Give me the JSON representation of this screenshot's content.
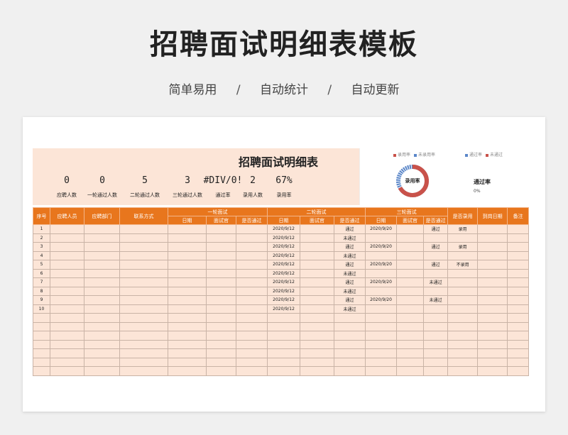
{
  "page_title": "招聘面试明细表模板",
  "tagline": [
    "简单易用",
    "自动统计",
    "自动更新"
  ],
  "tagline_sep": "/",
  "sheet": {
    "title": "招聘面试明细表",
    "stats": [
      {
        "value": "0",
        "label": "应聘人数"
      },
      {
        "value": "0",
        "label": "一轮通过人数"
      },
      {
        "value": "5",
        "label": "二轮通过人数"
      },
      {
        "value": "3",
        "label": "三轮通过人数"
      },
      {
        "value": "#DIV/0!",
        "label": "通过率"
      },
      {
        "value": "2",
        "label": "录用人数"
      },
      {
        "value": "67%",
        "label": "录用率"
      }
    ],
    "chart": {
      "legend_left": [
        "录用率",
        "未录用率"
      ],
      "legend_right": [
        "通过率",
        "未通过"
      ],
      "donut_label": "录用率",
      "donut_value": 0.67,
      "pass_label": "通过率",
      "pass_value": "0%",
      "colors": {
        "hired": "#c9524a",
        "not_hired": "#5b87c9"
      }
    },
    "table": {
      "headers": {
        "index": "序号",
        "applicant": "应聘人员",
        "department": "应聘部门",
        "contact": "联系方式",
        "round1": "一轮面试",
        "round2": "二轮面试",
        "round3": "三轮面试",
        "date": "日期",
        "interviewer": "面试官",
        "passed": "是否通过",
        "hired": "是否录用",
        "arrival": "到岗日期",
        "note": "备注"
      },
      "rows": [
        [
          "1",
          "",
          "",
          "",
          "",
          "",
          "",
          "2020/9/12",
          "",
          "通过",
          "2020/9/20",
          "",
          "通过",
          "录用",
          "",
          ""
        ],
        [
          "2",
          "",
          "",
          "",
          "",
          "",
          "",
          "2020/9/12",
          "",
          "未通过",
          "",
          "",
          "",
          "",
          "",
          ""
        ],
        [
          "3",
          "",
          "",
          "",
          "",
          "",
          "",
          "2020/9/12",
          "",
          "通过",
          "2020/9/20",
          "",
          "通过",
          "录用",
          "",
          ""
        ],
        [
          "4",
          "",
          "",
          "",
          "",
          "",
          "",
          "2020/9/12",
          "",
          "未通过",
          "",
          "",
          "",
          "",
          "",
          ""
        ],
        [
          "5",
          "",
          "",
          "",
          "",
          "",
          "",
          "2020/9/12",
          "",
          "通过",
          "2020/9/20",
          "",
          "通过",
          "不录用",
          "",
          ""
        ],
        [
          "6",
          "",
          "",
          "",
          "",
          "",
          "",
          "2020/9/12",
          "",
          "未通过",
          "",
          "",
          "",
          "",
          "",
          ""
        ],
        [
          "7",
          "",
          "",
          "",
          "",
          "",
          "",
          "2020/9/12",
          "",
          "通过",
          "2020/9/20",
          "",
          "未通过",
          "",
          "",
          ""
        ],
        [
          "8",
          "",
          "",
          "",
          "",
          "",
          "",
          "2020/9/12",
          "",
          "未通过",
          "",
          "",
          "",
          "",
          "",
          ""
        ],
        [
          "9",
          "",
          "",
          "",
          "",
          "",
          "",
          "2020/9/12",
          "",
          "通过",
          "2020/9/20",
          "",
          "未通过",
          "",
          "",
          ""
        ],
        [
          "10",
          "",
          "",
          "",
          "",
          "",
          "",
          "2020/9/12",
          "",
          "未通过",
          "",
          "",
          "",
          "",
          "",
          ""
        ],
        [
          "",
          "",
          "",
          "",
          "",
          "",
          "",
          "",
          "",
          "",
          "",
          "",
          "",
          "",
          "",
          ""
        ],
        [
          "",
          "",
          "",
          "",
          "",
          "",
          "",
          "",
          "",
          "",
          "",
          "",
          "",
          "",
          "",
          ""
        ],
        [
          "",
          "",
          "",
          "",
          "",
          "",
          "",
          "",
          "",
          "",
          "",
          "",
          "",
          "",
          "",
          ""
        ],
        [
          "",
          "",
          "",
          "",
          "",
          "",
          "",
          "",
          "",
          "",
          "",
          "",
          "",
          "",
          "",
          ""
        ],
        [
          "",
          "",
          "",
          "",
          "",
          "",
          "",
          "",
          "",
          "",
          "",
          "",
          "",
          "",
          "",
          ""
        ],
        [
          "",
          "",
          "",
          "",
          "",
          "",
          "",
          "",
          "",
          "",
          "",
          "",
          "",
          "",
          "",
          ""
        ],
        [
          "",
          "",
          "",
          "",
          "",
          "",
          "",
          "",
          "",
          "",
          "",
          "",
          "",
          "",
          "",
          ""
        ]
      ]
    }
  }
}
